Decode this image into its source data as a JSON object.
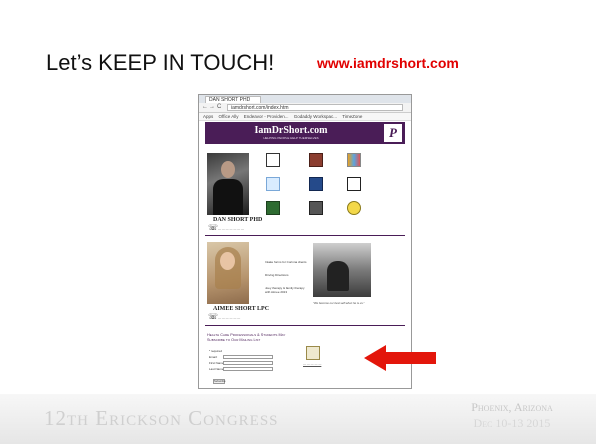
{
  "slide": {
    "title": "Let’s KEEP IN TOUCH!",
    "url": "www.iamdrshort.com",
    "footer_left": "12th Erickson Congress",
    "footer_right_line1": "Phoenix, Arizona",
    "footer_right_line2": "Dec 10-13 2015",
    "arrow_color": "#e3160b"
  },
  "browser": {
    "tab_label": "DAN SHORT PHD",
    "address": "iamdrshort.com/index.htm",
    "bookmarks": [
      "Apps",
      "Office Ally",
      "Endeavor - Providen...",
      "Godaddy Workspac...",
      "TimeZone"
    ]
  },
  "website": {
    "site_title": "IamDrShort.com",
    "tagline": "HELPING PEOPLE HELP THEMSELVES",
    "logo_letter": "P",
    "dan_name": "DAN SHORT PHD",
    "aimee_name": "AIMEE SHORT LPC",
    "phone_icon": "phone-icon",
    "signup_heading_line1": "Health Care Professionals & Students May",
    "signup_heading_line2": "Subscribe to Our Mailing List",
    "form_labels": [
      "Email:",
      "First Name:",
      "Last Name:"
    ],
    "form_required": "* required",
    "submit_label": "Subscribe",
    "caption": "\"We become our best self when he is us.\"",
    "aimee_links": [
      "Intake forms for Corinna clients",
      "Driving Directions",
      "Joey therapy & family therapy with Aimee 2013"
    ]
  }
}
